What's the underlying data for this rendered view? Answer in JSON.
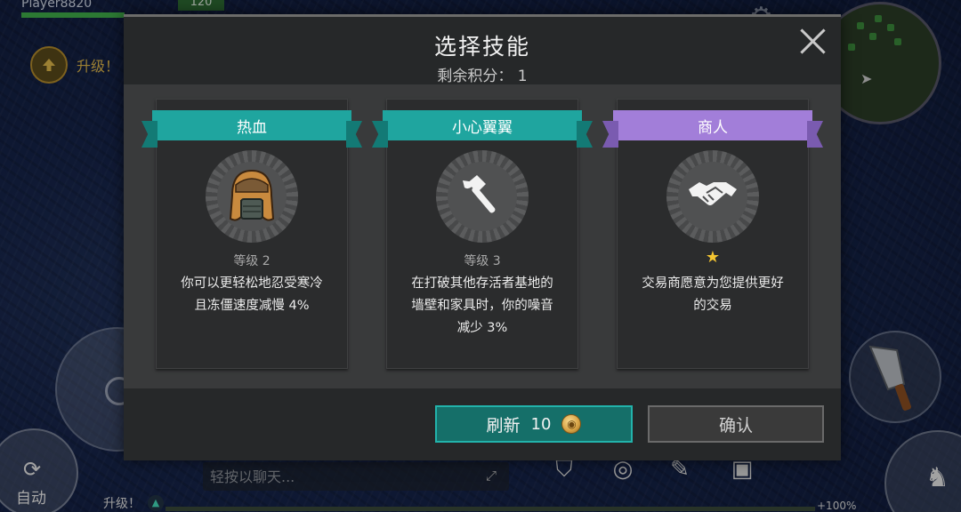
{
  "hud": {
    "player_name": "Player8820",
    "hp_value": "120",
    "levelup_top_label": "升级！",
    "auto_label": "自动",
    "chat_placeholder": "轻按以聊天...",
    "levelup_bottom_label": "升级！",
    "xp_percent": "+100%"
  },
  "dialog": {
    "title": "选择技能",
    "points_label": "剩余积分：",
    "points_value": "1",
    "cards": [
      {
        "name": "热血",
        "ribbon_color": "#1fa59f",
        "icon": "fur-hat-icon",
        "level": "等级 2",
        "description": "你可以更轻松地忍受寒冷\n且冻僵速度减慢 4%"
      },
      {
        "name": "小心翼翼",
        "ribbon_color": "#1fa59f",
        "icon": "axe-icon",
        "level": "等级 3",
        "description": "在打破其他存活者基地的\n墙壁和家具时，你的噪音\n减少 3%"
      },
      {
        "name": "商人",
        "ribbon_color": "#a27ed9",
        "icon": "handshake-icon",
        "level_icon": "star-icon",
        "description": "交易商愿意为您提供更好\n的交易"
      }
    ],
    "refresh_label": "刷新",
    "refresh_cost": "10",
    "confirm_label": "确认"
  }
}
